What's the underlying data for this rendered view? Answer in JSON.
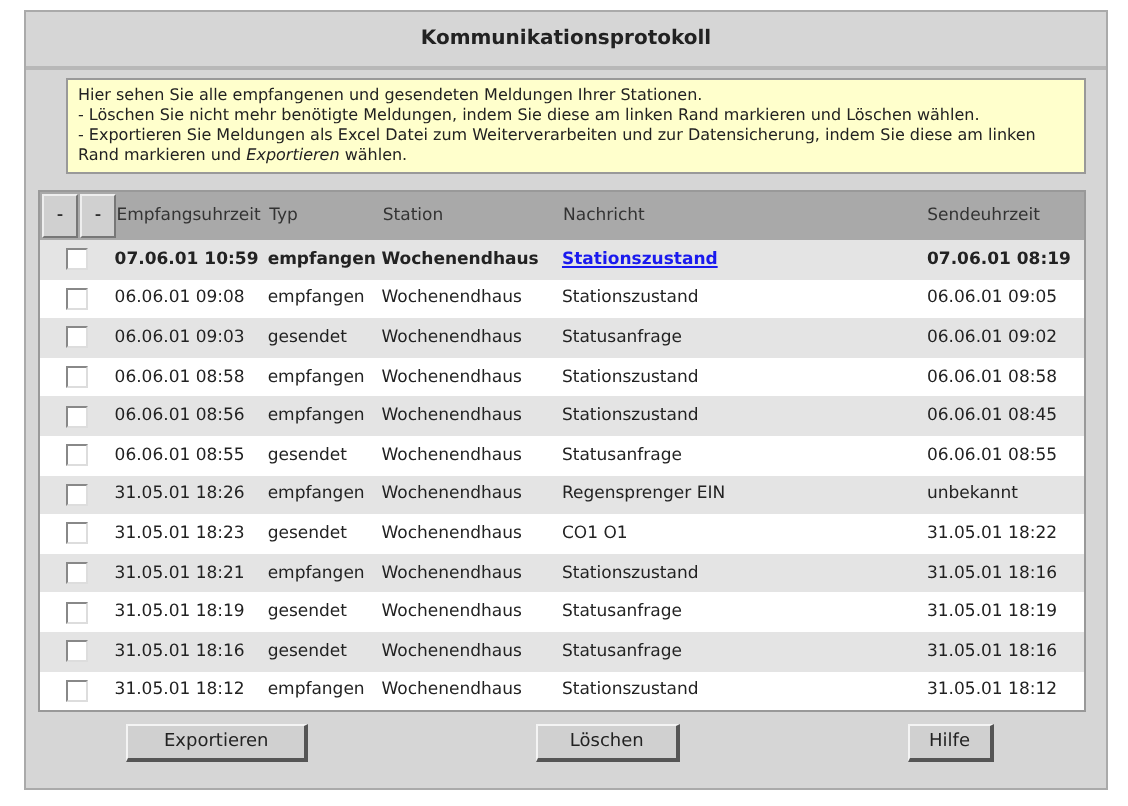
{
  "window": {
    "title": "Kommunikationsprotokoll"
  },
  "info": [
    "Hier sehen Sie alle empfangenen und gesendeten Meldungen Ihrer Stationen.",
    "- Löschen Sie nicht mehr benötigte Meldungen, indem Sie diese am linken Rand markieren und Löschen wählen.",
    "- Exportieren Sie Meldungen als Excel Datei zum Weiterverarbeiten und zur Datensicherung, indem Sie diese am linken Rand markieren und *Exportieren* wählen."
  ],
  "table": {
    "header_buttons": [
      "-",
      "-"
    ],
    "columns": [
      "Empfangsuhrzeit",
      "Typ",
      "Station",
      "Nachricht",
      "Sendeuhrzeit"
    ],
    "rows": [
      {
        "checked": false,
        "unread": true,
        "cells": [
          "07.06.01 10:59",
          "empfangen",
          "Wochenendhaus",
          "Stationszustand",
          "07.06.01 08:19"
        ]
      },
      {
        "checked": false,
        "unread": false,
        "cells": [
          "06.06.01 09:08",
          "empfangen",
          "Wochenendhaus",
          "Stationszustand",
          "06.06.01 09:05"
        ]
      },
      {
        "checked": false,
        "unread": false,
        "cells": [
          "06.06.01 09:03",
          "gesendet",
          "Wochenendhaus",
          "Statusanfrage",
          "06.06.01 09:02"
        ]
      },
      {
        "checked": false,
        "unread": false,
        "cells": [
          "06.06.01 08:58",
          "empfangen",
          "Wochenendhaus",
          "Stationszustand",
          "06.06.01 08:58"
        ]
      },
      {
        "checked": false,
        "unread": false,
        "cells": [
          "06.06.01 08:56",
          "empfangen",
          "Wochenendhaus",
          "Stationszustand",
          "06.06.01 08:45"
        ]
      },
      {
        "checked": false,
        "unread": false,
        "cells": [
          "06.06.01 08:55",
          "gesendet",
          "Wochenendhaus",
          "Statusanfrage",
          "06.06.01 08:55"
        ]
      },
      {
        "checked": false,
        "unread": false,
        "cells": [
          "31.05.01 18:26",
          "empfangen",
          "Wochenendhaus",
          "Regensprenger EIN",
          "unbekannt"
        ]
      },
      {
        "checked": false,
        "unread": false,
        "cells": [
          "31.05.01 18:23",
          "gesendet",
          "Wochenendhaus",
          "CO1 O1",
          "31.05.01 18:22"
        ]
      },
      {
        "checked": false,
        "unread": false,
        "cells": [
          "31.05.01 18:21",
          "empfangen",
          "Wochenendhaus",
          "Stationszustand",
          "31.05.01 18:16"
        ]
      },
      {
        "checked": false,
        "unread": false,
        "cells": [
          "31.05.01 18:19",
          "gesendet",
          "Wochenendhaus",
          "Statusanfrage",
          "31.05.01 18:19"
        ]
      },
      {
        "checked": false,
        "unread": false,
        "cells": [
          "31.05.01 18:16",
          "gesendet",
          "Wochenendhaus",
          "Statusanfrage",
          "31.05.01 18:16"
        ]
      },
      {
        "checked": false,
        "unread": false,
        "cells": [
          "31.05.01 18:12",
          "empfangen",
          "Wochenendhaus",
          "Stationszustand",
          "31.05.01 18:12"
        ]
      }
    ]
  },
  "buttons": [
    "Exportieren",
    "Löschen",
    "Hilfe"
  ]
}
